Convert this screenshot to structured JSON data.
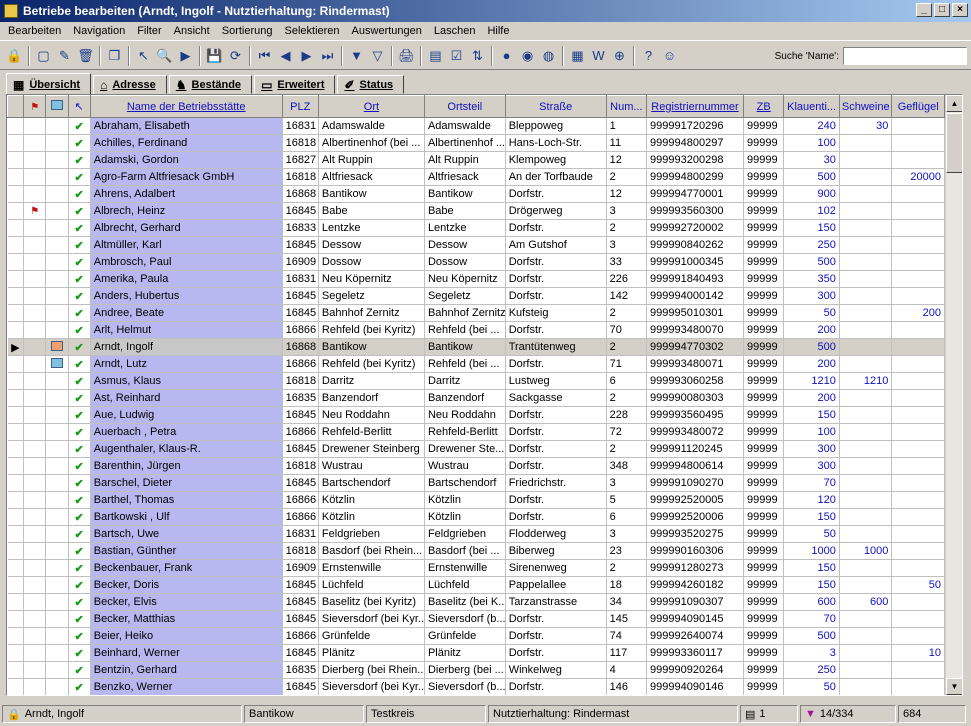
{
  "window": {
    "title": "Betriebe bearbeiten   (Arndt, Ingolf - Nutztierhaltung: Rindermast)",
    "min": "_",
    "max": "□",
    "close": "×"
  },
  "menu": [
    "Bearbeiten",
    "Navigation",
    "Filter",
    "Ansicht",
    "Sortierung",
    "Selektieren",
    "Auswertungen",
    "Laschen",
    "Hilfe"
  ],
  "toolbar": {
    "icons": [
      "lock-icon",
      "new-doc-icon",
      "edit-doc-icon",
      "delete-icon",
      "copy-icon",
      "pointer-icon",
      "find-icon",
      "run-icon",
      "save-icon",
      "refresh-icon",
      "first-icon",
      "prev-icon",
      "next-icon",
      "last-icon",
      "filter-icon",
      "filter-edit-icon",
      "print-icon",
      "form-icon",
      "check-doc-icon",
      "sort-icon",
      "globe-icon",
      "globe2-icon",
      "network-icon",
      "book-icon",
      "word-icon",
      "export-icon",
      "help-icon",
      "user-icon"
    ],
    "glyphs": [
      "🔒",
      "▢",
      "✎",
      "🗑",
      "❐",
      "↖",
      "🔍",
      "▶",
      "💾",
      "⟳",
      "⏮",
      "◀",
      "▶",
      "⏭",
      "▼",
      "▽",
      "🖨",
      "▤",
      "☑",
      "⇅",
      "●",
      "◉",
      "◍",
      "▦",
      "W",
      "⊕",
      "?",
      "☺"
    ],
    "search_label": "Suche 'Name':",
    "search_value": ""
  },
  "tabs": [
    {
      "label": "Übersicht",
      "icon": "grid-icon",
      "glyph": "▦",
      "active": true
    },
    {
      "label": "Adresse",
      "icon": "house-icon",
      "glyph": "⌂",
      "active": false
    },
    {
      "label": "Bestände",
      "icon": "animal-icon",
      "glyph": "♞",
      "active": false
    },
    {
      "label": "Erweitert",
      "icon": "window-icon",
      "glyph": "▭",
      "active": false
    },
    {
      "label": "Status",
      "icon": "pen-icon",
      "glyph": "✐",
      "active": false
    }
  ],
  "columns": {
    "name": "Name der Betriebsstätte",
    "plz": "PLZ",
    "ort": "Ort",
    "ortsteil": "Ortsteil",
    "strasse": "Straße",
    "num": "Num...",
    "reg": "Registriernummer",
    "zb": "ZB",
    "klauen": "Klauenti...",
    "schweine": "Schweine",
    "gefluegel": "Geflügel"
  },
  "rows": [
    {
      "name": "Abraham, Elisabeth",
      "plz": "16831",
      "ort": "Adamswalde",
      "ortsteil": "Adamswalde",
      "strasse": "Bleppoweg",
      "num": "1",
      "reg": "999991720296",
      "zb": "99999",
      "klauen": "240",
      "schweine": "30",
      "gefluegel": ""
    },
    {
      "name": "Achilles, Ferdinand",
      "plz": "16818",
      "ort": "Albertinenhof (bei ...",
      "ortsteil": "Albertinenhof ...",
      "strasse": "Hans-Loch-Str.",
      "num": "11",
      "reg": "999994800297",
      "zb": "99999",
      "klauen": "100",
      "schweine": "",
      "gefluegel": ""
    },
    {
      "name": "Adamski, Gordon",
      "plz": "16827",
      "ort": "Alt Ruppin",
      "ortsteil": "Alt Ruppin",
      "strasse": "Klempoweg",
      "num": "12",
      "reg": "999993200298",
      "zb": "99999",
      "klauen": "30",
      "schweine": "",
      "gefluegel": ""
    },
    {
      "name": "Agro-Farm Altfriesack GmbH",
      "plz": "16818",
      "ort": "Altfriesack",
      "ortsteil": "Altfriesack",
      "strasse": "An der Torfbaude",
      "num": "2",
      "reg": "999994800299",
      "zb": "99999",
      "klauen": "500",
      "schweine": "",
      "gefluegel": "20000"
    },
    {
      "name": "Ahrens, Adalbert",
      "plz": "16868",
      "ort": "Bantikow",
      "ortsteil": "Bantikow",
      "strasse": "Dorfstr.",
      "num": "12",
      "reg": "999994770001",
      "zb": "99999",
      "klauen": "900",
      "schweine": "",
      "gefluegel": ""
    },
    {
      "name": "Albrech, Heinz",
      "plz": "16845",
      "ort": "Babe",
      "ortsteil": "Babe",
      "strasse": "Drögerweg",
      "num": "3",
      "reg": "999993560300",
      "zb": "99999",
      "klauen": "102",
      "schweine": "",
      "gefluegel": "",
      "flag": true
    },
    {
      "name": "Albrecht, Gerhard",
      "plz": "16833",
      "ort": "Lentzke",
      "ortsteil": "Lentzke",
      "strasse": "Dorfstr.",
      "num": "2",
      "reg": "999992720002",
      "zb": "99999",
      "klauen": "150",
      "schweine": "",
      "gefluegel": ""
    },
    {
      "name": "Altmüller, Karl",
      "plz": "16845",
      "ort": "Dessow",
      "ortsteil": "Dessow",
      "strasse": "Am Gutshof",
      "num": "3",
      "reg": "999990840262",
      "zb": "99999",
      "klauen": "250",
      "schweine": "",
      "gefluegel": ""
    },
    {
      "name": "Ambrosch, Paul",
      "plz": "16909",
      "ort": "Dossow",
      "ortsteil": "Dossow",
      "strasse": "Dorfstr.",
      "num": "33",
      "reg": "999991000345",
      "zb": "99999",
      "klauen": "500",
      "schweine": "",
      "gefluegel": ""
    },
    {
      "name": "Amerika, Paula",
      "plz": "16831",
      "ort": "Neu Köpernitz",
      "ortsteil": "Neu Köpernitz",
      "strasse": "Dorfstr.",
      "num": "226",
      "reg": "999991840493",
      "zb": "99999",
      "klauen": "350",
      "schweine": "",
      "gefluegel": ""
    },
    {
      "name": "Anders, Hubertus",
      "plz": "16845",
      "ort": "Segeletz",
      "ortsteil": "Segeletz",
      "strasse": "Dorfstr.",
      "num": "142",
      "reg": "999994000142",
      "zb": "99999",
      "klauen": "300",
      "schweine": "",
      "gefluegel": ""
    },
    {
      "name": "Andree, Beate",
      "plz": "16845",
      "ort": "Bahnhof Zernitz",
      "ortsteil": "Bahnhof Zernitz",
      "strasse": "Kufsteig",
      "num": "2",
      "reg": "999995010301",
      "zb": "99999",
      "klauen": "50",
      "schweine": "",
      "gefluegel": "200"
    },
    {
      "name": "Arlt, Helmut",
      "plz": "16866",
      "ort": "Rehfeld (bei Kyritz)",
      "ortsteil": "Rehfeld (bei ...",
      "strasse": "Dorfstr.",
      "num": "70",
      "reg": "999993480070",
      "zb": "99999",
      "klauen": "200",
      "schweine": "",
      "gefluegel": ""
    },
    {
      "name": "Arndt, Ingolf",
      "plz": "16868",
      "ort": "Bantikow",
      "ortsteil": "Bantikow",
      "strasse": "Trantütenweg",
      "num": "2",
      "reg": "999994770302",
      "zb": "99999",
      "klauen": "500",
      "schweine": "",
      "gefluegel": "",
      "selected": true,
      "pc": "orange"
    },
    {
      "name": "Arndt, Lutz",
      "plz": "16866",
      "ort": "Rehfeld (bei Kyritz)",
      "ortsteil": "Rehfeld (bei ...",
      "strasse": "Dorfstr.",
      "num": "71",
      "reg": "999993480071",
      "zb": "99999",
      "klauen": "200",
      "schweine": "",
      "gefluegel": "",
      "pc": "blue"
    },
    {
      "name": "Asmus, Klaus",
      "plz": "16818",
      "ort": "Darritz",
      "ortsteil": "Darritz",
      "strasse": "Lustweg",
      "num": "6",
      "reg": "999993060258",
      "zb": "99999",
      "klauen": "1210",
      "schweine": "1210",
      "gefluegel": ""
    },
    {
      "name": "Ast, Reinhard",
      "plz": "16835",
      "ort": "Banzendorf",
      "ortsteil": "Banzendorf",
      "strasse": "Sackgasse",
      "num": "2",
      "reg": "999990080303",
      "zb": "99999",
      "klauen": "200",
      "schweine": "",
      "gefluegel": ""
    },
    {
      "name": "Aue, Ludwig",
      "plz": "16845",
      "ort": "Neu Roddahn",
      "ortsteil": "Neu Roddahn",
      "strasse": "Dorfstr.",
      "num": "228",
      "reg": "999993560495",
      "zb": "99999",
      "klauen": "150",
      "schweine": "",
      "gefluegel": ""
    },
    {
      "name": "Auerbach , Petra",
      "plz": "16866",
      "ort": "Rehfeld-Berlitt",
      "ortsteil": "Rehfeld-Berlitt",
      "strasse": "Dorfstr.",
      "num": "72",
      "reg": "999993480072",
      "zb": "99999",
      "klauen": "100",
      "schweine": "",
      "gefluegel": ""
    },
    {
      "name": "Augenthaler, Klaus-R.",
      "plz": "16845",
      "ort": "Drewener Steinberg",
      "ortsteil": "Drewener Ste...",
      "strasse": "Dorfstr.",
      "num": "2",
      "reg": "999991120245",
      "zb": "99999",
      "klauen": "300",
      "schweine": "",
      "gefluegel": ""
    },
    {
      "name": "Barenthin, Jürgen",
      "plz": "16818",
      "ort": "Wustrau",
      "ortsteil": "Wustrau",
      "strasse": "Dorfstr.",
      "num": "348",
      "reg": "999994800614",
      "zb": "99999",
      "klauen": "300",
      "schweine": "",
      "gefluegel": ""
    },
    {
      "name": "Barschel, Dieter",
      "plz": "16845",
      "ort": "Bartschendorf",
      "ortsteil": "Bartschendorf",
      "strasse": "Friedrichstr.",
      "num": "3",
      "reg": "999991090270",
      "zb": "99999",
      "klauen": "70",
      "schweine": "",
      "gefluegel": ""
    },
    {
      "name": "Barthel, Thomas",
      "plz": "16866",
      "ort": "Kötzlin",
      "ortsteil": "Kötzlin",
      "strasse": "Dorfstr.",
      "num": "5",
      "reg": "999992520005",
      "zb": "99999",
      "klauen": "120",
      "schweine": "",
      "gefluegel": ""
    },
    {
      "name": "Bartkowski , Ulf",
      "plz": "16866",
      "ort": "Kötzlin",
      "ortsteil": "Kötzlin",
      "strasse": "Dorfstr.",
      "num": "6",
      "reg": "999992520006",
      "zb": "99999",
      "klauen": "150",
      "schweine": "",
      "gefluegel": ""
    },
    {
      "name": "Bartsch, Uwe",
      "plz": "16831",
      "ort": "Feldgrieben",
      "ortsteil": "Feldgrieben",
      "strasse": "Flodderweg",
      "num": "3",
      "reg": "999993520275",
      "zb": "99999",
      "klauen": "50",
      "schweine": "",
      "gefluegel": ""
    },
    {
      "name": "Bastian, Günther",
      "plz": "16818",
      "ort": "Basdorf (bei Rhein...",
      "ortsteil": "Basdorf (bei ...",
      "strasse": "Biberweg",
      "num": "23",
      "reg": "999990160306",
      "zb": "99999",
      "klauen": "1000",
      "schweine": "1000",
      "gefluegel": ""
    },
    {
      "name": "Beckenbauer, Frank",
      "plz": "16909",
      "ort": "Ernstenwille",
      "ortsteil": "Ernstenwille",
      "strasse": "Sirenenweg",
      "num": "2",
      "reg": "999991280273",
      "zb": "99999",
      "klauen": "150",
      "schweine": "",
      "gefluegel": ""
    },
    {
      "name": "Becker, Doris",
      "plz": "16845",
      "ort": "Lüchfeld",
      "ortsteil": "Lüchfeld",
      "strasse": "Pappelallee",
      "num": "18",
      "reg": "999994260182",
      "zb": "99999",
      "klauen": "150",
      "schweine": "",
      "gefluegel": "50"
    },
    {
      "name": "Becker, Elvis",
      "plz": "16845",
      "ort": "Baselitz (bei Kyritz)",
      "ortsteil": "Baselitz (bei K...",
      "strasse": "Tarzanstrasse",
      "num": "34",
      "reg": "999991090307",
      "zb": "99999",
      "klauen": "600",
      "schweine": "600",
      "gefluegel": ""
    },
    {
      "name": "Becker, Matthias",
      "plz": "16845",
      "ort": "Sieversdorf (bei Kyr...",
      "ortsteil": "Sieversdorf (b...",
      "strasse": "Dorfstr.",
      "num": "145",
      "reg": "999994090145",
      "zb": "99999",
      "klauen": "70",
      "schweine": "",
      "gefluegel": ""
    },
    {
      "name": "Beier, Heiko",
      "plz": "16866",
      "ort": "Grünfelde",
      "ortsteil": "Grünfelde",
      "strasse": "Dorfstr.",
      "num": "74",
      "reg": "999992640074",
      "zb": "99999",
      "klauen": "500",
      "schweine": "",
      "gefluegel": ""
    },
    {
      "name": "Beinhard, Werner",
      "plz": "16845",
      "ort": "Plänitz",
      "ortsteil": "Plänitz",
      "strasse": "Dorfstr.",
      "num": "117",
      "reg": "999993360117",
      "zb": "99999",
      "klauen": "3",
      "schweine": "",
      "gefluegel": "10"
    },
    {
      "name": "Bentzin, Gerhard",
      "plz": "16835",
      "ort": "Dierberg (bei Rhein...",
      "ortsteil": "Dierberg (bei ...",
      "strasse": "Winkelweg",
      "num": "4",
      "reg": "999990920264",
      "zb": "99999",
      "klauen": "250",
      "schweine": "",
      "gefluegel": ""
    },
    {
      "name": "Benzko, Werner",
      "plz": "16845",
      "ort": "Sieversdorf (bei Kyr...",
      "ortsteil": "Sieversdorf (b...",
      "strasse": "Dorfstr.",
      "num": "146",
      "reg": "999994090146",
      "zb": "99999",
      "klauen": "50",
      "schweine": "",
      "gefluegel": ""
    }
  ],
  "status": {
    "user": "Arndt, Ingolf",
    "ort": "Bantikow",
    "kreis": "Testkreis",
    "haltung": "Nutztierhaltung: Rindermast",
    "sel_count": "1",
    "filter": "14/334",
    "total": "684"
  }
}
